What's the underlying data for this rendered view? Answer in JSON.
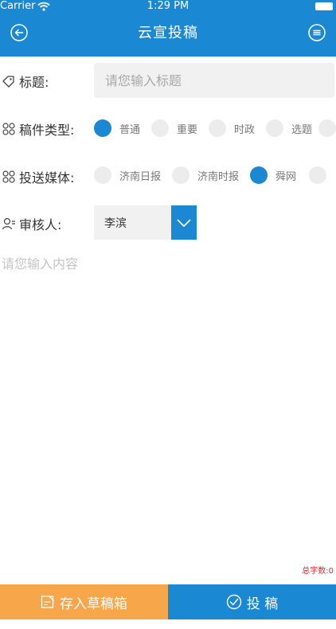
{
  "status_bar": {
    "carrier": "Carrier",
    "time": "1:29 PM"
  },
  "header": {
    "title": "云宣投稿"
  },
  "form": {
    "title_label": "标题:",
    "title_placeholder": "请您输入标题",
    "type_label": "稿件类型:",
    "type_options": [
      {
        "label": "普通",
        "selected": true
      },
      {
        "label": "重要",
        "selected": false
      },
      {
        "label": "时政",
        "selected": false
      },
      {
        "label": "选题",
        "selected": false
      }
    ],
    "media_label": "投送媒体:",
    "media_options": [
      {
        "label": "济南日报",
        "selected": false
      },
      {
        "label": "济南时报",
        "selected": false
      },
      {
        "label": "舜网",
        "selected": true
      }
    ],
    "reviewer_label": "审核人:",
    "reviewer_value": "李滨",
    "content_placeholder": "请您输入内容"
  },
  "word_count": "总字数:0",
  "actions": {
    "save_draft": "存入草稿箱",
    "submit": "投 稿"
  },
  "colors": {
    "primary": "#1b88d4",
    "draft": "#f7a649",
    "count": "#e0262c"
  }
}
